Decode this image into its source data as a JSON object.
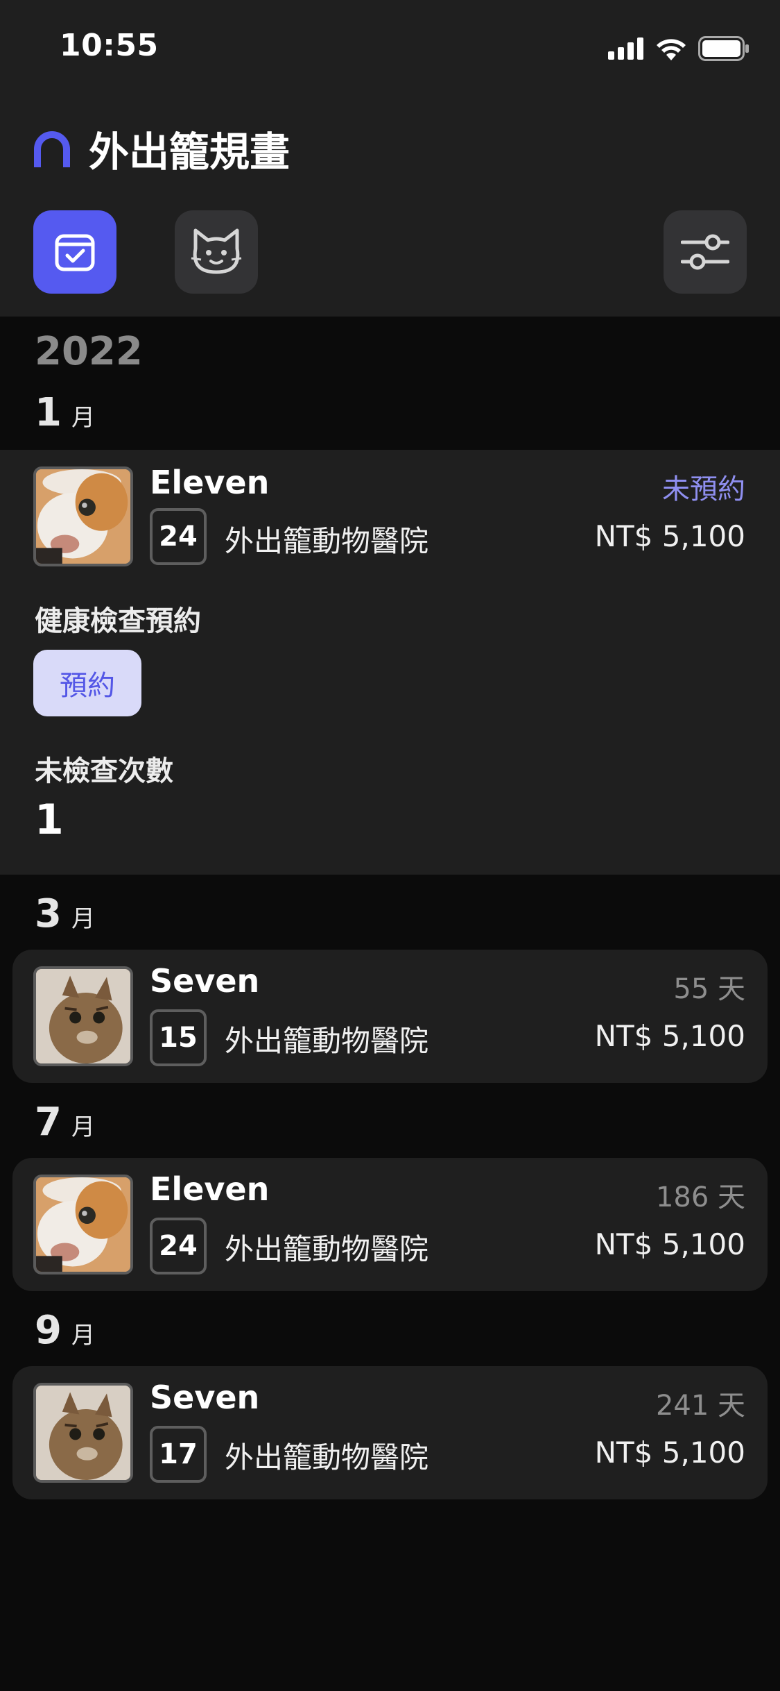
{
  "status_bar": {
    "time": "10:55"
  },
  "app": {
    "title": "外出籠規畫"
  },
  "toolbar": {
    "plan_icon": "calendar-check-icon",
    "cat_icon": "cat-face-icon",
    "settings_icon": "sliders-icon",
    "active_color": "#555af0"
  },
  "year": "2022",
  "months": [
    {
      "num": "1",
      "unit": "月"
    },
    {
      "num": "3",
      "unit": "月"
    },
    {
      "num": "7",
      "unit": "月"
    },
    {
      "num": "9",
      "unit": "月"
    }
  ],
  "entries": [
    {
      "pet": "Eleven",
      "day": "24",
      "clinic": "外出籠動物醫院",
      "status": "未預約",
      "price": "NT$ 5,100",
      "health_check_label": "健康檢查預約",
      "reserve_label": "預約",
      "unchecked_label": "未檢查次數",
      "unchecked_count": "1"
    },
    {
      "pet": "Seven",
      "day": "15",
      "clinic": "外出籠動物醫院",
      "days_left": "55 天",
      "price": "NT$ 5,100"
    },
    {
      "pet": "Eleven",
      "day": "24",
      "clinic": "外出籠動物醫院",
      "days_left": "186 天",
      "price": "NT$ 5,100"
    },
    {
      "pet": "Seven",
      "day": "17",
      "clinic": "外出籠動物醫院",
      "days_left": "241 天",
      "price": "NT$ 5,100"
    }
  ]
}
